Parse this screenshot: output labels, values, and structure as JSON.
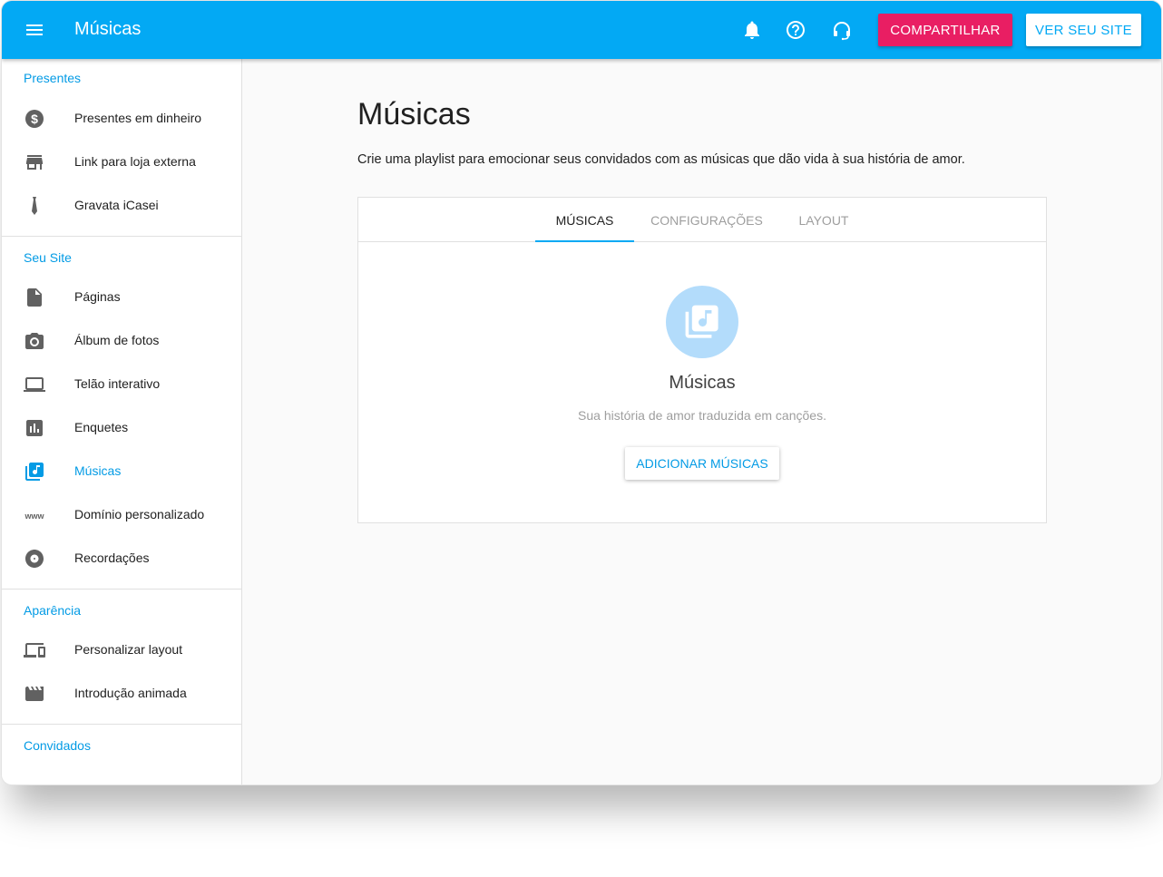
{
  "topbar": {
    "title": "Músicas",
    "icons": [
      "menu-icon",
      "bell-icon",
      "help-icon",
      "support-headset-icon"
    ],
    "share_label": "COMPARTILHAR",
    "view_site_label": "VER SEU SITE",
    "colors": {
      "bar": "#03a9f4",
      "share": "#e91e63"
    }
  },
  "sidebar": {
    "sections": [
      {
        "title": "Presentes",
        "items": [
          {
            "label": "Presentes em dinheiro",
            "icon": "dollar-coin-icon"
          },
          {
            "label": "Link para loja externa",
            "icon": "store-icon"
          },
          {
            "label": "Gravata iCasei",
            "icon": "tie-icon"
          }
        ]
      },
      {
        "title": "Seu Site",
        "items": [
          {
            "label": "Páginas",
            "icon": "page-icon"
          },
          {
            "label": "Álbum de fotos",
            "icon": "camera-icon"
          },
          {
            "label": "Telão interativo",
            "icon": "monitor-icon"
          },
          {
            "label": "Enquetes",
            "icon": "poll-chart-icon"
          },
          {
            "label": "Músicas",
            "icon": "music-library-icon",
            "active": true
          },
          {
            "label": "Domínio personalizado",
            "icon": "www-icon"
          },
          {
            "label": "Recordações",
            "icon": "disc-icon"
          }
        ]
      },
      {
        "title": "Aparência",
        "items": [
          {
            "label": "Personalizar layout",
            "icon": "devices-icon"
          },
          {
            "label": "Introdução animada",
            "icon": "clapperboard-icon"
          }
        ]
      },
      {
        "title": "Convidados",
        "items": []
      }
    ]
  },
  "main": {
    "title": "Músicas",
    "description": "Crie uma playlist para emocionar seus convidados com as músicas que dão vida à sua história de amor.",
    "tabs": [
      {
        "label": "MÚSICAS",
        "active": true
      },
      {
        "label": "CONFIGURAÇÕES"
      },
      {
        "label": "LAYOUT"
      }
    ],
    "empty_state": {
      "icon": "music-library-icon",
      "title": "Músicas",
      "subtitle": "Sua história de amor traduzida em canções.",
      "button_label": "ADICIONAR MÚSICAS"
    }
  }
}
